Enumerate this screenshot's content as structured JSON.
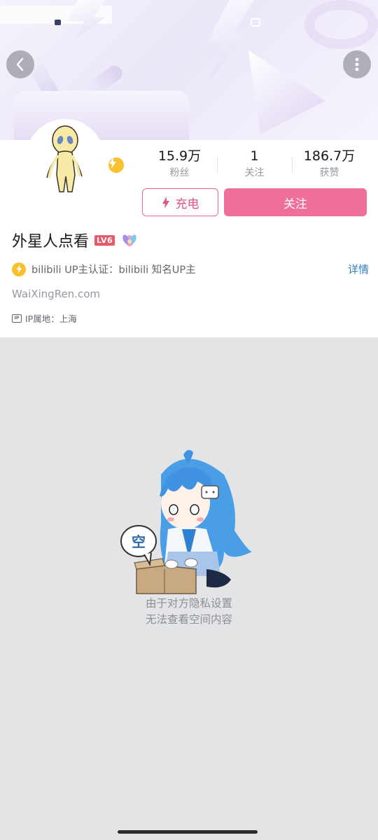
{
  "banner": {
    "back_icon": "chevron-left-icon",
    "more_icon": "more-vertical-icon"
  },
  "profile": {
    "avatar_icon": "alien-avatar",
    "stats": [
      {
        "value": "15.9万",
        "label": "粉丝"
      },
      {
        "value": "1",
        "label": "关注"
      },
      {
        "value": "186.7万",
        "label": "获赞"
      }
    ],
    "charge_label": "充电",
    "follow_label": "关注",
    "name": "外星人点看",
    "level": "LV6",
    "verification": "bilibili UP主认证：bilibili 知名UP主",
    "detail_label": "详情",
    "website": "WaiXingRen.com",
    "ip_badge": "IP",
    "ip_location": "IP属地：上海"
  },
  "empty_state": {
    "bubble_text": "空",
    "line1": "由于对方隐私设置",
    "line2": "无法查看空间内容"
  },
  "colors": {
    "accent_pink": "#ef6f99",
    "verify_gold": "#fbc02d",
    "link_blue": "#2e7fc1",
    "empty_bg": "#e3e4e6"
  }
}
